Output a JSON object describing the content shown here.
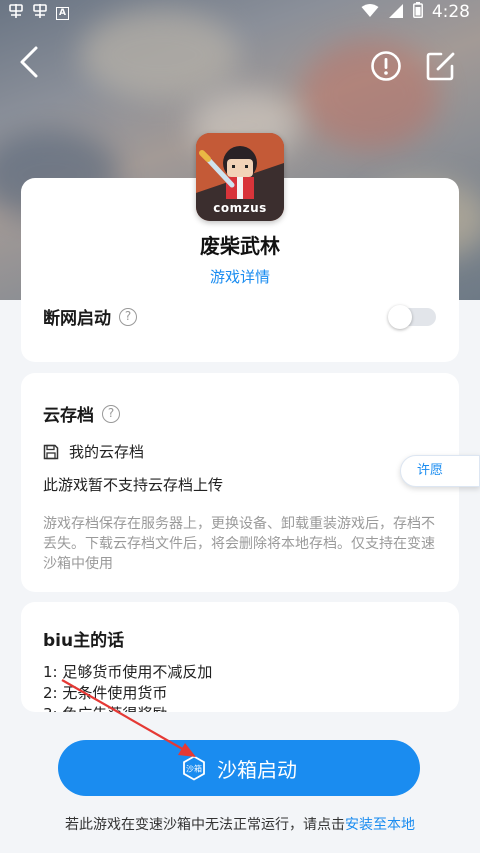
{
  "status_bar": {
    "time": "4:28",
    "notification_icons": [
      "app-notification-icon",
      "app-notification-icon",
      "a-badge-icon"
    ],
    "a_badge_letter": "A",
    "system_icons": [
      "wifi-icon",
      "signal-icon",
      "battery-icon"
    ]
  },
  "header": {
    "back_icon": "chevron-left-icon",
    "info_icon": "exclamation-circle-icon",
    "edit_icon": "edit-square-icon"
  },
  "app": {
    "icon_brand": "comzus",
    "title": "废柴武林",
    "detail_link": "游戏详情"
  },
  "offline": {
    "label": "断网启动",
    "help_glyph": "?",
    "enabled": false
  },
  "cloud": {
    "title": "云存档",
    "help_glyph": "?",
    "my_save_label": "我的云存档",
    "note": "此游戏暂不支持云存档上传",
    "description": "游戏存档保存在服务器上，更换设备、卸载重装游戏后，存档不丢失。下载云存档文件后，将会删除将本地存档。仅支持在变速沙箱中使用",
    "wish_button": "许愿"
  },
  "author": {
    "title": "biu主的话",
    "items": [
      "1:  足够货币使用不减反加",
      "2:  无条件使用货币",
      "3:  免广告获得奖励"
    ]
  },
  "bottom": {
    "launch_icon_text": "沙箱",
    "launch_label": "沙箱启动",
    "note_prefix": "若此游戏在变速沙箱中无法正常运行，请点击",
    "note_link": "安装至本地"
  },
  "colors": {
    "accent": "#1a8cf0",
    "annotation_arrow": "#e53935"
  }
}
